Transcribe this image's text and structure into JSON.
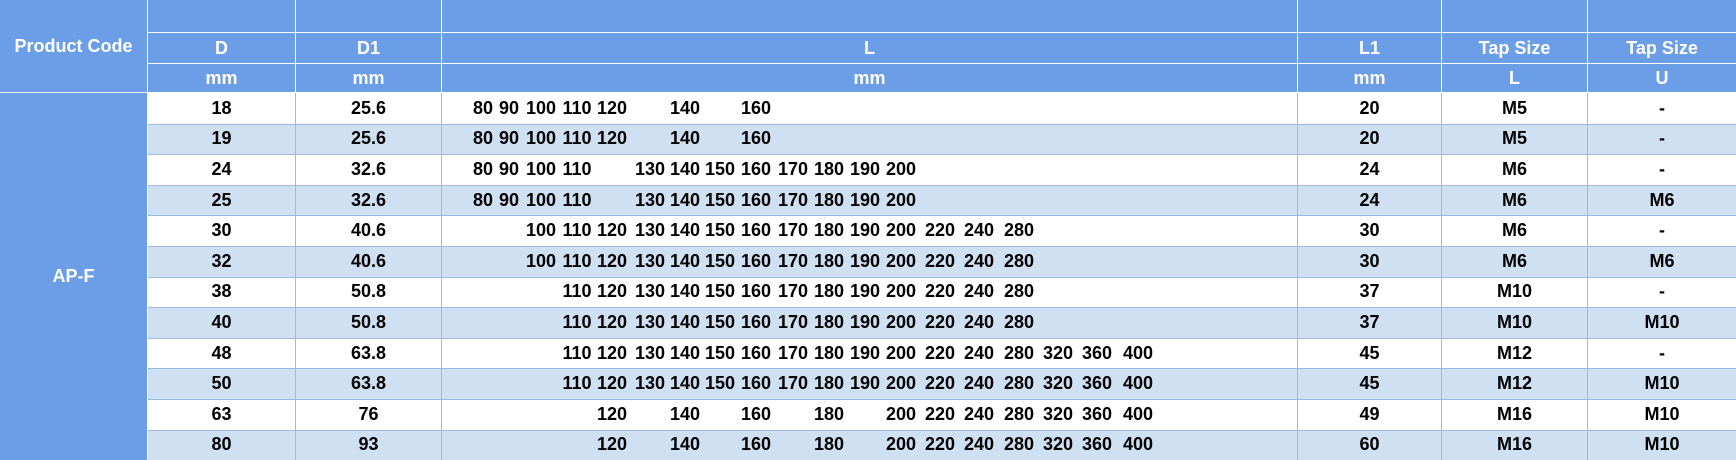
{
  "table": {
    "header": {
      "product_code": "Product Code",
      "cols": [
        {
          "key": "d",
          "name": "D",
          "unit": "mm"
        },
        {
          "key": "d1",
          "name": "D1",
          "unit": "mm"
        },
        {
          "key": "l",
          "name": "L",
          "unit": "mm"
        },
        {
          "key": "l1",
          "name": "L1",
          "unit": "mm"
        },
        {
          "key": "tapl",
          "name": "Tap Size",
          "unit": "L"
        },
        {
          "key": "tapu",
          "name": "Tap Size",
          "unit": "U"
        }
      ]
    },
    "product_code_value": "AP-F",
    "l_slots": [
      "80",
      "90",
      "100",
      "110",
      "120",
      "130",
      "140",
      "150",
      "160",
      "170",
      "180",
      "190",
      "200",
      "220",
      "240",
      "280",
      "320",
      "360",
      "400"
    ],
    "rows": [
      {
        "d": "18",
        "d1": "25.6",
        "l": [
          "80",
          "90",
          "100",
          "110",
          "120",
          "140",
          "160"
        ],
        "l1": "20",
        "tapl": "M5",
        "tapu": "-"
      },
      {
        "d": "19",
        "d1": "25.6",
        "l": [
          "80",
          "90",
          "100",
          "110",
          "120",
          "140",
          "160"
        ],
        "l1": "20",
        "tapl": "M5",
        "tapu": "-"
      },
      {
        "d": "24",
        "d1": "32.6",
        "l": [
          "80",
          "90",
          "100",
          "110",
          "130",
          "140",
          "150",
          "160",
          "170",
          "180",
          "190",
          "200"
        ],
        "l1": "24",
        "tapl": "M6",
        "tapu": "-"
      },
      {
        "d": "25",
        "d1": "32.6",
        "l": [
          "80",
          "90",
          "100",
          "110",
          "130",
          "140",
          "150",
          "160",
          "170",
          "180",
          "190",
          "200"
        ],
        "l1": "24",
        "tapl": "M6",
        "tapu": "M6"
      },
      {
        "d": "30",
        "d1": "40.6",
        "l": [
          "100",
          "110",
          "120",
          "130",
          "140",
          "150",
          "160",
          "170",
          "180",
          "190",
          "200",
          "220",
          "240",
          "280"
        ],
        "l1": "30",
        "tapl": "M6",
        "tapu": "-"
      },
      {
        "d": "32",
        "d1": "40.6",
        "l": [
          "100",
          "110",
          "120",
          "130",
          "140",
          "150",
          "160",
          "170",
          "180",
          "190",
          "200",
          "220",
          "240",
          "280"
        ],
        "l1": "30",
        "tapl": "M6",
        "tapu": "M6"
      },
      {
        "d": "38",
        "d1": "50.8",
        "l": [
          "110",
          "120",
          "130",
          "140",
          "150",
          "160",
          "170",
          "180",
          "190",
          "200",
          "220",
          "240",
          "280"
        ],
        "l1": "37",
        "tapl": "M10",
        "tapu": "-"
      },
      {
        "d": "40",
        "d1": "50.8",
        "l": [
          "110",
          "120",
          "130",
          "140",
          "150",
          "160",
          "170",
          "180",
          "190",
          "200",
          "220",
          "240",
          "280"
        ],
        "l1": "37",
        "tapl": "M10",
        "tapu": "M10"
      },
      {
        "d": "48",
        "d1": "63.8",
        "l": [
          "110",
          "120",
          "130",
          "140",
          "150",
          "160",
          "170",
          "180",
          "190",
          "200",
          "220",
          "240",
          "280",
          "320",
          "360",
          "400"
        ],
        "l1": "45",
        "tapl": "M12",
        "tapu": "-"
      },
      {
        "d": "50",
        "d1": "63.8",
        "l": [
          "110",
          "120",
          "130",
          "140",
          "150",
          "160",
          "170",
          "180",
          "190",
          "200",
          "220",
          "240",
          "280",
          "320",
          "360",
          "400"
        ],
        "l1": "45",
        "tapl": "M12",
        "tapu": "M10"
      },
      {
        "d": "63",
        "d1": "76",
        "l": [
          "120",
          "140",
          "160",
          "180",
          "200",
          "220",
          "240",
          "280",
          "320",
          "360",
          "400"
        ],
        "l1": "49",
        "tapl": "M16",
        "tapu": "M10"
      },
      {
        "d": "80",
        "d1": "93",
        "l": [
          "120",
          "140",
          "160",
          "180",
          "200",
          "220",
          "240",
          "280",
          "320",
          "360",
          "400"
        ],
        "l1": "60",
        "tapl": "M16",
        "tapu": "M10"
      }
    ]
  },
  "colors": {
    "header_bg": "#6c9ee8",
    "alt_row_bg": "#cfe0f3",
    "plain_row_bg": "#ffffff",
    "grid_line": "#9eb9dd"
  }
}
